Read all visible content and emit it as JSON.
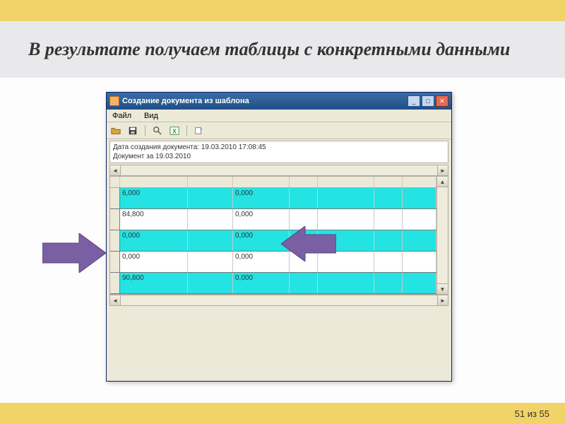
{
  "slide": {
    "title": "В результате получаем таблицы с конкретными данными",
    "pager_prefix": "51",
    "pager_mid": " из ",
    "pager_total": "55"
  },
  "window": {
    "title": "Создание документа из шаблона",
    "menu": {
      "file": "Файл",
      "view": "Вид"
    },
    "info_line1": "Дата создания документа: 19.03.2010 17:08:45",
    "info_line2": "Документ за 19.03.2010"
  },
  "grid": {
    "rows": [
      {
        "c1": "6,000",
        "c3": "0,000"
      },
      {
        "c1": "84,800",
        "c3": "0,000"
      },
      {
        "c1": "0,000",
        "c3": "0,000"
      },
      {
        "c1": "0,000",
        "c3": "0,000"
      },
      {
        "c1": "90,800",
        "c3": "0,000"
      }
    ]
  }
}
